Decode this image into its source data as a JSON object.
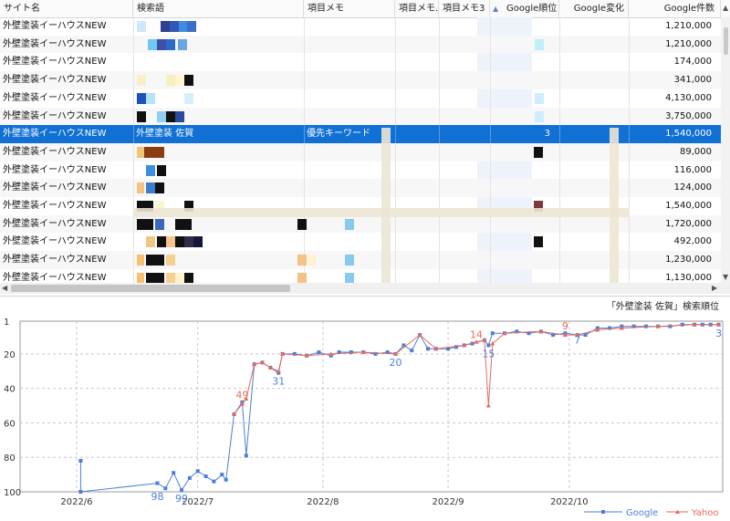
{
  "grid": {
    "columns": [
      {
        "key": "site",
        "label": "サイト名"
      },
      {
        "key": "keyword",
        "label": "検索語"
      },
      {
        "key": "memo1",
        "label": "項目メモ"
      },
      {
        "key": "memo2",
        "label": "項目メモ..."
      },
      {
        "key": "memo3",
        "label": "項目メモ3"
      },
      {
        "key": "grank",
        "label": "Google順位"
      },
      {
        "key": "gchange",
        "label": "Google変化"
      },
      {
        "key": "gcount",
        "label": "Google件数"
      }
    ],
    "sorted_column": "Google順位",
    "rows": [
      {
        "site": "外壁塗装イーハウスNEW",
        "keyword": "",
        "memo1": "",
        "rank": "",
        "count": "1,210,000"
      },
      {
        "site": "外壁塗装イーハウスNEW",
        "keyword": "",
        "memo1": "",
        "rank": "",
        "count": "1,210,000"
      },
      {
        "site": "外壁塗装イーハウスNEW",
        "keyword": "",
        "memo1": "",
        "rank": "",
        "count": "174,000"
      },
      {
        "site": "外壁塗装イーハウスNEW",
        "keyword": "",
        "memo1": "",
        "rank": "",
        "count": "341,000"
      },
      {
        "site": "外壁塗装イーハウスNEW",
        "keyword": "",
        "memo1": "",
        "rank": "",
        "count": "4,130,000"
      },
      {
        "site": "外壁塗装イーハウスNEW",
        "keyword": "",
        "memo1": "",
        "rank": "",
        "count": "3,750,000"
      },
      {
        "site": "外壁塗装イーハウスNEW",
        "keyword": "外壁塗装 佐賀",
        "memo1": "優先キーワード",
        "rank": "3",
        "count": "1,540,000"
      },
      {
        "site": "外壁塗装イーハウスNEW",
        "keyword": "",
        "memo1": "",
        "rank": "",
        "count": "89,000"
      },
      {
        "site": "外壁塗装イーハウスNEW",
        "keyword": "",
        "memo1": "",
        "rank": "",
        "count": "116,000"
      },
      {
        "site": "外壁塗装イーハウスNEW",
        "keyword": "",
        "memo1": "",
        "rank": "",
        "count": "124,000"
      },
      {
        "site": "外壁塗装イーハウスNEW",
        "keyword": "",
        "memo1": "",
        "rank": "",
        "count": "1,540,000"
      },
      {
        "site": "外壁塗装イーハウスNEW",
        "keyword": "",
        "memo1": "",
        "rank": "",
        "count": "1,720,000"
      },
      {
        "site": "外壁塗装イーハウスNEW",
        "keyword": "",
        "memo1": "",
        "rank": "",
        "count": "492,000"
      },
      {
        "site": "外壁塗装イーハウスNEW",
        "keyword": "",
        "memo1": "",
        "rank": "",
        "count": "1,230,000"
      },
      {
        "site": "外壁塗装イーハウスNEW",
        "keyword": "",
        "memo1": "",
        "rank": "",
        "count": "1,130,000"
      }
    ],
    "selected_row_index": 6
  },
  "chart_data": {
    "type": "line",
    "title": "「外壁塗装 佐賀」検索順位",
    "x_tick_labels": [
      "2022/6",
      "2022/7",
      "2022/8",
      "2022/9",
      "2022/10"
    ],
    "y_tick_labels": [
      "1",
      "20",
      "40",
      "60",
      "80",
      "100"
    ],
    "ylim": [
      1,
      100
    ],
    "y_inverted": true,
    "grid": true,
    "legend_position": "bottom-right",
    "colors": {
      "Google": "#4a7fd8",
      "Yahoo": "#e86a5a"
    },
    "series": [
      {
        "name": "Google",
        "points": [
          [
            "2022-06-02",
            82
          ],
          [
            "2022-06-02",
            100
          ],
          [
            "2022-06-21",
            95
          ],
          [
            "2022-06-23",
            98
          ],
          [
            "2022-06-25",
            89
          ],
          [
            "2022-06-27",
            99
          ],
          [
            "2022-06-29",
            92
          ],
          [
            "2022-07-01",
            88
          ],
          [
            "2022-07-03",
            91
          ],
          [
            "2022-07-05",
            94
          ],
          [
            "2022-07-07",
            90
          ],
          [
            "2022-07-08",
            93
          ],
          [
            "2022-07-10",
            55
          ],
          [
            "2022-07-12",
            48
          ],
          [
            "2022-07-13",
            79
          ],
          [
            "2022-07-15",
            26
          ],
          [
            "2022-07-17",
            25
          ],
          [
            "2022-07-19",
            28
          ],
          [
            "2022-07-21",
            31
          ],
          [
            "2022-07-22",
            20
          ],
          [
            "2022-07-25",
            20
          ],
          [
            "2022-07-28",
            21
          ],
          [
            "2022-07-31",
            19
          ],
          [
            "2022-08-03",
            21
          ],
          [
            "2022-08-05",
            19
          ],
          [
            "2022-08-08",
            19
          ],
          [
            "2022-08-11",
            19
          ],
          [
            "2022-08-14",
            20
          ],
          [
            "2022-08-17",
            19
          ],
          [
            "2022-08-19",
            20
          ],
          [
            "2022-08-21",
            15
          ],
          [
            "2022-08-23",
            18
          ],
          [
            "2022-08-25",
            9
          ],
          [
            "2022-08-27",
            17
          ],
          [
            "2022-08-29",
            17
          ],
          [
            "2022-09-01",
            17
          ],
          [
            "2022-09-03",
            16
          ],
          [
            "2022-09-05",
            15
          ],
          [
            "2022-09-07",
            14
          ],
          [
            "2022-09-10",
            12
          ],
          [
            "2022-09-11",
            15
          ],
          [
            "2022-09-12",
            8
          ],
          [
            "2022-09-15",
            8
          ],
          [
            "2022-09-18",
            7
          ],
          [
            "2022-09-21",
            8
          ],
          [
            "2022-09-24",
            7
          ],
          [
            "2022-09-27",
            9
          ],
          [
            "2022-09-30",
            8
          ],
          [
            "2022-10-03",
            9
          ],
          [
            "2022-10-05",
            9
          ],
          [
            "2022-10-08",
            5
          ],
          [
            "2022-10-11",
            5
          ],
          [
            "2022-10-14",
            4
          ],
          [
            "2022-10-17",
            4
          ],
          [
            "2022-10-20",
            4
          ],
          [
            "2022-10-23",
            4
          ],
          [
            "2022-10-26",
            4
          ],
          [
            "2022-10-29",
            3
          ],
          [
            "2022-11-01",
            3
          ],
          [
            "2022-11-03",
            3
          ],
          [
            "2022-11-05",
            3
          ],
          [
            "2022-11-07",
            3
          ]
        ]
      },
      {
        "name": "Yahoo",
        "points": [
          [
            "2022-07-10",
            55
          ],
          [
            "2022-07-12",
            49
          ],
          [
            "2022-07-13",
            46
          ],
          [
            "2022-07-15",
            26
          ],
          [
            "2022-07-17",
            25
          ],
          [
            "2022-07-19",
            28
          ],
          [
            "2022-07-21",
            30
          ],
          [
            "2022-07-22",
            20
          ],
          [
            "2022-07-28",
            21
          ],
          [
            "2022-08-03",
            20
          ],
          [
            "2022-08-11",
            19
          ],
          [
            "2022-08-19",
            20
          ],
          [
            "2022-08-25",
            9
          ],
          [
            "2022-08-29",
            17
          ],
          [
            "2022-09-05",
            15
          ],
          [
            "2022-09-08",
            13
          ],
          [
            "2022-09-10",
            12
          ],
          [
            "2022-09-11",
            50
          ],
          [
            "2022-09-12",
            14
          ],
          [
            "2022-09-15",
            8
          ],
          [
            "2022-09-24",
            7
          ],
          [
            "2022-09-30",
            9
          ],
          [
            "2022-10-03",
            9
          ],
          [
            "2022-10-08",
            6
          ],
          [
            "2022-10-14",
            5
          ],
          [
            "2022-10-23",
            4
          ],
          [
            "2022-11-01",
            3
          ],
          [
            "2022-11-07",
            3
          ]
        ]
      }
    ],
    "annotations": [
      {
        "text": "98",
        "series": "Google",
        "x": "2022-06-21",
        "y": 98
      },
      {
        "text": "99",
        "series": "Google",
        "x": "2022-06-27",
        "y": 99
      },
      {
        "text": "49",
        "series": "Yahoo",
        "x": "2022-07-12",
        "y": 49
      },
      {
        "text": "31",
        "series": "Google",
        "x": "2022-07-21",
        "y": 31
      },
      {
        "text": "20",
        "series": "Google",
        "x": "2022-08-19",
        "y": 20
      },
      {
        "text": "14",
        "series": "Yahoo",
        "x": "2022-09-08",
        "y": 14
      },
      {
        "text": "15",
        "series": "Google",
        "x": "2022-09-11",
        "y": 15
      },
      {
        "text": "9",
        "series": "Yahoo",
        "x": "2022-09-30",
        "y": 9
      },
      {
        "text": "7",
        "series": "Google",
        "x": "2022-10-03",
        "y": 7
      },
      {
        "text": "3",
        "series": "Google",
        "x": "2022-11-07",
        "y": 3
      }
    ]
  }
}
